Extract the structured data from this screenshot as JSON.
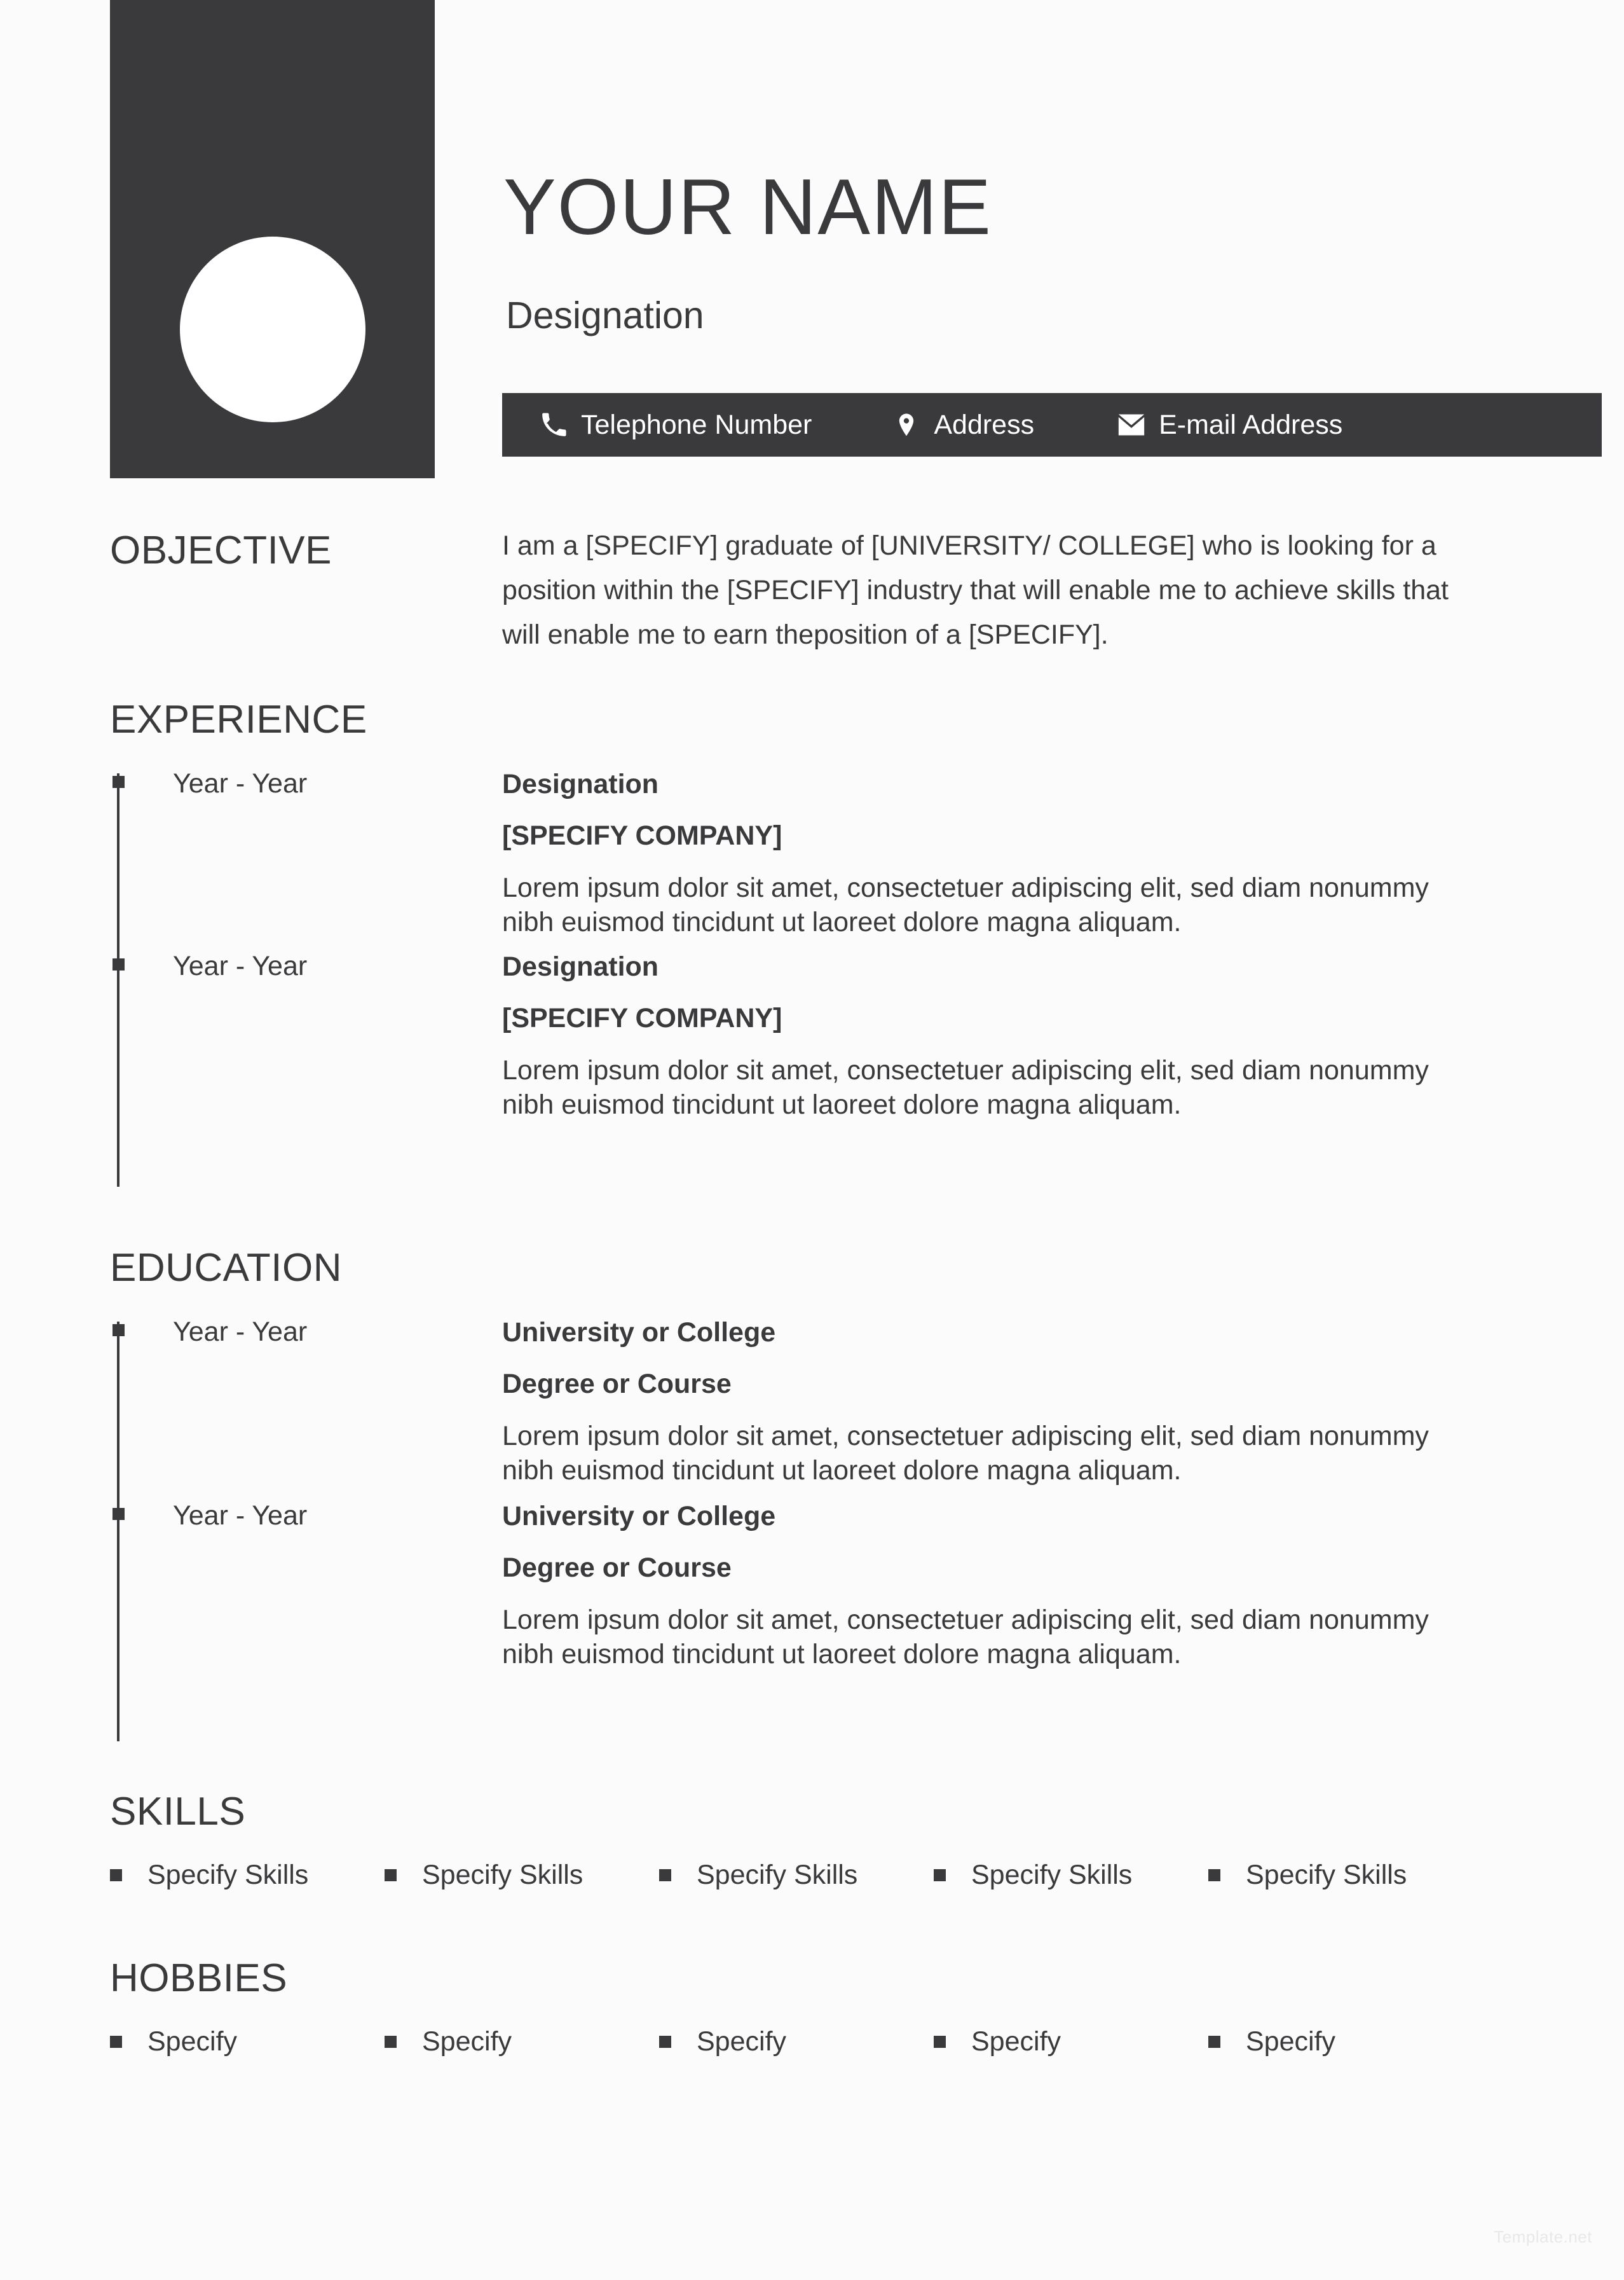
{
  "document": {
    "background_color": "#fbfbfb",
    "accent_color": "#3a3a3c",
    "watermark": "Template.net"
  },
  "header": {
    "name": "YOUR NAME",
    "designation": "Designation",
    "photo_placeholder": "photo-placeholder",
    "contact": [
      {
        "icon": "phone-icon",
        "label": "Telephone Number"
      },
      {
        "icon": "location-pin-icon",
        "label": "Address"
      },
      {
        "icon": "envelope-icon",
        "label": "E-mail Address"
      }
    ]
  },
  "objective": {
    "title": "OBJECTIVE",
    "text": "I am a [SPECIFY] graduate of [UNIVERSITY/ COLLEGE] who is looking for a position within the [SPECIFY] industry that will enable me to achieve skills that will enable me to earn theposition of a [SPECIFY]."
  },
  "experience": {
    "title": "EXPERIENCE",
    "entries": [
      {
        "year": "Year - Year",
        "line1": "Designation",
        "line2": "[SPECIFY COMPANY]",
        "description": "Lorem ipsum dolor sit amet, consectetuer adipiscing elit, sed diam nonummy nibh euismod tincidunt ut laoreet dolore magna aliquam."
      },
      {
        "year": "Year - Year",
        "line1": "Designation",
        "line2": "[SPECIFY COMPANY]",
        "description": "Lorem ipsum dolor sit amet, consectetuer adipiscing elit, sed diam nonummy nibh euismod tincidunt ut laoreet dolore magna aliquam."
      }
    ]
  },
  "education": {
    "title": "EDUCATION",
    "entries": [
      {
        "year": "Year - Year",
        "line1": "University or College",
        "line2": "Degree or Course",
        "description": "Lorem ipsum dolor sit amet, consectetuer adipiscing elit, sed diam nonummy nibh euismod tincidunt ut laoreet dolore magna aliquam."
      },
      {
        "year": "Year - Year",
        "line1": "University or College",
        "line2": "Degree or Course",
        "description": "Lorem ipsum dolor sit amet, consectetuer adipiscing elit, sed diam nonummy nibh euismod tincidunt ut laoreet dolore magna aliquam."
      }
    ]
  },
  "skills": {
    "title": "SKILLS",
    "items": [
      "Specify Skills",
      "Specify Skills",
      "Specify Skills",
      "Specify Skills",
      "Specify Skills"
    ]
  },
  "hobbies": {
    "title": "HOBBIES",
    "items": [
      "Specify",
      "Specify",
      "Specify",
      "Specify",
      "Specify"
    ]
  }
}
